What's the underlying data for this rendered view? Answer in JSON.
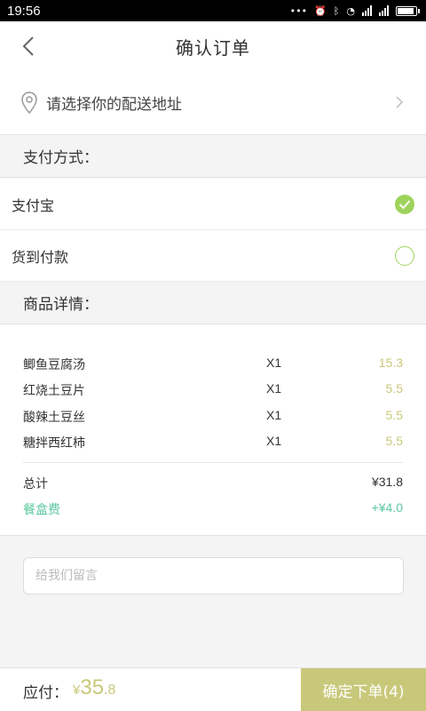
{
  "status_bar": {
    "time": "19:56"
  },
  "header": {
    "title": "确认订单"
  },
  "address": {
    "placeholder_text": "请选择你的配送地址"
  },
  "payment": {
    "section_title": "支付方式：",
    "options": [
      {
        "label": "支付宝",
        "selected": true
      },
      {
        "label": "货到付款",
        "selected": false
      }
    ]
  },
  "details": {
    "section_title": "商品详情：",
    "items": [
      {
        "name": "鲫鱼豆腐汤",
        "qty": "X1",
        "price": "15.3"
      },
      {
        "name": "红烧土豆片",
        "qty": "X1",
        "price": "5.5"
      },
      {
        "name": "酸辣土豆丝",
        "qty": "X1",
        "price": "5.5"
      },
      {
        "name": "糖拌西红柿",
        "qty": "X1",
        "price": "5.5"
      }
    ],
    "total_label": "总计",
    "total_value": "¥31.8",
    "box_fee_label": "餐盒费",
    "box_fee_value": "+¥4.0"
  },
  "message": {
    "placeholder": "给我们留言"
  },
  "footer": {
    "pay_label": "应付：",
    "currency": "¥",
    "amount_int": "35",
    "amount_dec": ".8",
    "submit_label": "确定下单(4)"
  },
  "colors": {
    "accent": "#c8c87a",
    "check_green": "#9dd35a",
    "fee_green": "#5cc8a0"
  }
}
